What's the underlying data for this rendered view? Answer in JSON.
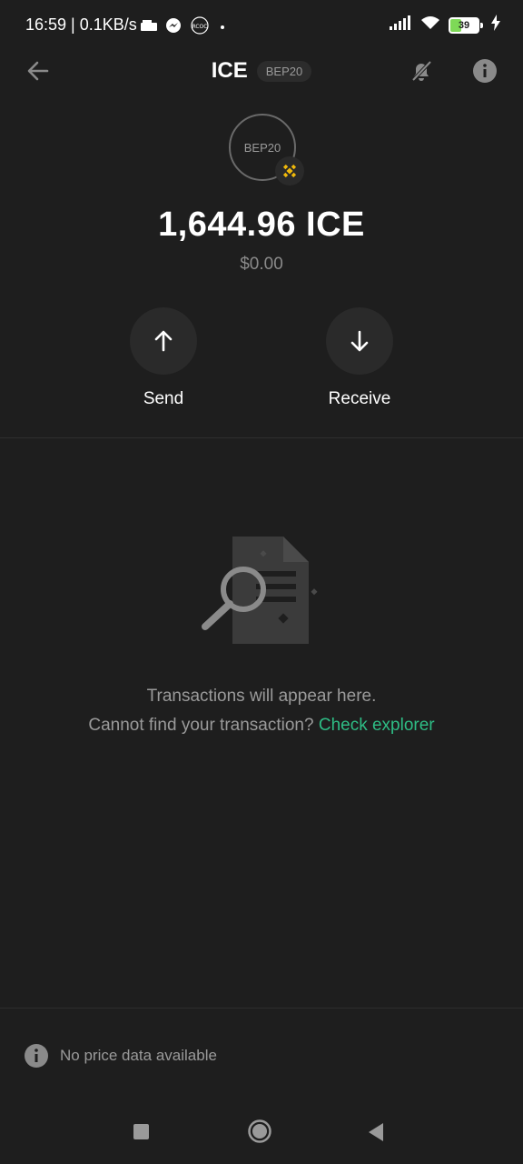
{
  "status_bar": {
    "time_text": "16:59 | 0.1KB/s",
    "battery_level": "39",
    "icons": [
      "storage-icon",
      "messenger-icon",
      "rcoc-icon",
      "dot-icon",
      "signal-icon",
      "wifi-icon",
      "battery-icon",
      "charging-icon"
    ]
  },
  "header": {
    "title": "ICE",
    "network_chip": "BEP20"
  },
  "token": {
    "logo_text": "BEP20",
    "badge_icon": "bnb-icon",
    "balance": "1,644.96 ICE",
    "fiat_value": "$0.00"
  },
  "actions": {
    "send_label": "Send",
    "receive_label": "Receive"
  },
  "empty_state": {
    "line1": "Transactions will appear here.",
    "line2_prefix": "Cannot find your transaction? ",
    "link_text": "Check explorer"
  },
  "footer": {
    "info_text": "No price data available"
  },
  "colors": {
    "background": "#1e1e1e",
    "accent_green": "#2ebd85",
    "bnb_yellow": "#f0b90b",
    "muted_text": "#9a9a9a"
  }
}
